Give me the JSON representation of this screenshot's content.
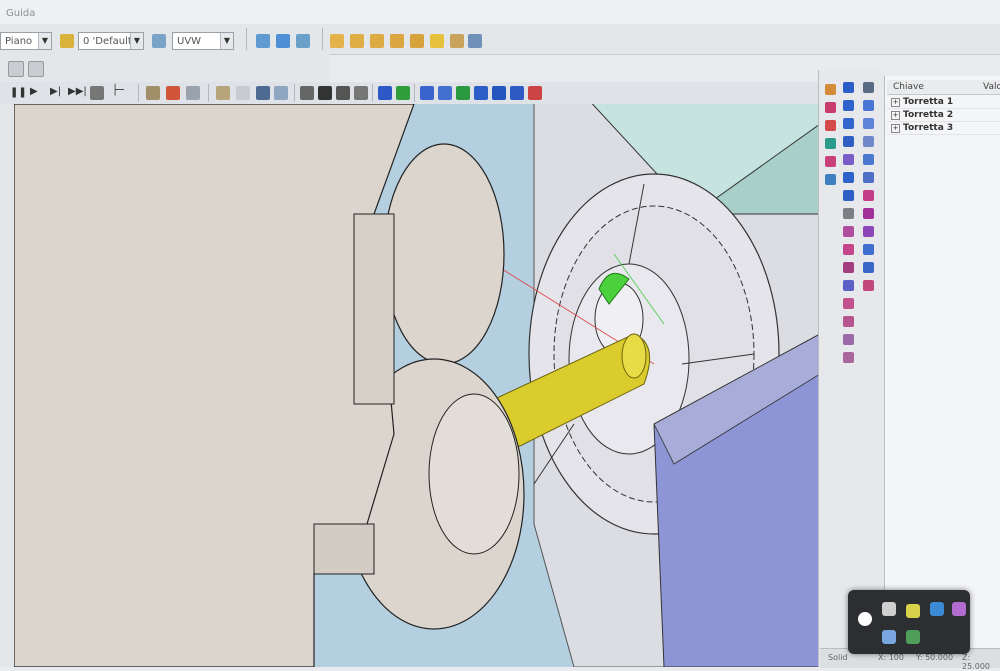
{
  "menu": {
    "guida": "Guida"
  },
  "toolbar": {
    "plane_combo": "Piano",
    "layer_combo": "0 'Default'",
    "uvw_combo": "UVW"
  },
  "tree": {
    "col_key": "Chiave",
    "col_value": "Valore",
    "items": [
      "Torretta 1",
      "Torretta 2",
      "Torretta 3"
    ]
  },
  "status": {
    "left": "Solid",
    "mid1": "X: 100",
    "mid2": "Y: 50.000",
    "right": "Z: 25.000"
  },
  "colors": {
    "workpiece": "#d9cc2c",
    "insert": "#4bd13c",
    "machine_body": "#dbd5cd",
    "background": "#b4d0e0",
    "blue_block": "#8e95d6",
    "teal_block": "#c6e3df"
  }
}
